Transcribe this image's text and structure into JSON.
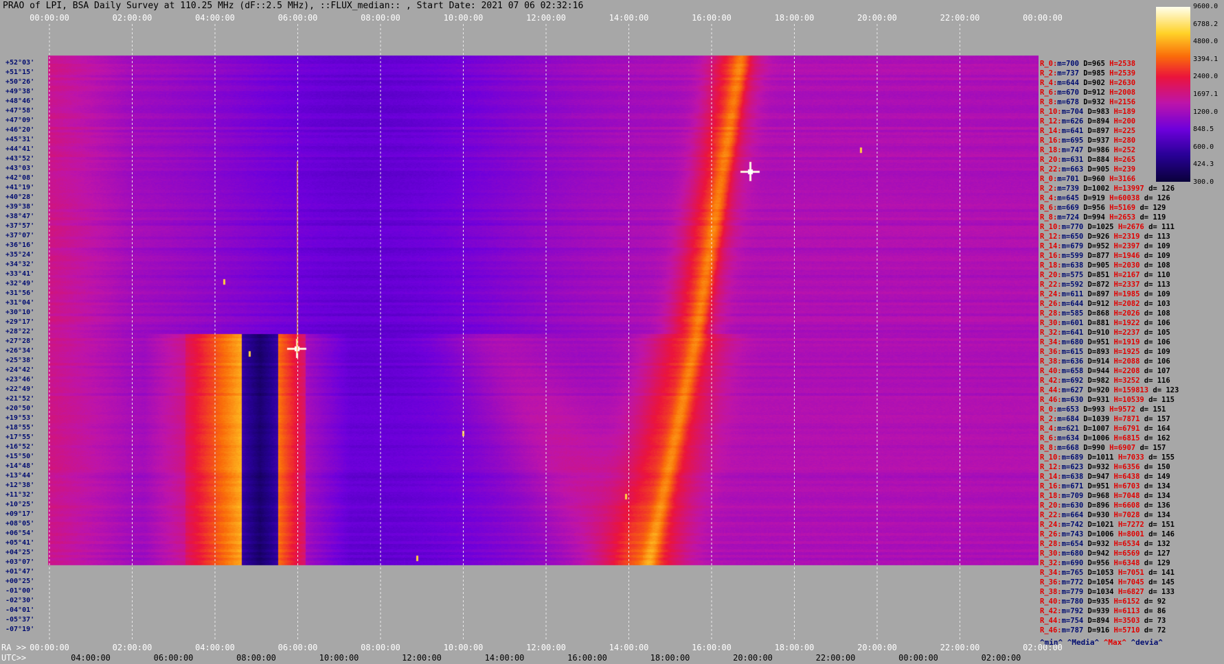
{
  "title": "PRAO of LPI, BSA Daily Survey at 110.25 MHz (dF::2.5 MHz), ::FLUX_median:: , Start Date: 2021 07 06 02:32:16",
  "axis_labels": {
    "ra": "RA >>",
    "utc": "UTC>>"
  },
  "footer": {
    "min": "^min^",
    "media": "^Media^",
    "max": "^Max^",
    "devia": "^devia^"
  },
  "chart_data": {
    "type": "heatmap",
    "title": "PRAO of LPI, BSA Daily Survey at 110.25 MHz (dF::2.5 MHz), ::FLUX_median:: , Start Date: 2021 07 06 02:32:16",
    "x_top_ticks": [
      "00:00:00",
      "02:00:00",
      "04:00:00",
      "06:00:00",
      "08:00:00",
      "10:00:00",
      "12:00:00",
      "14:00:00",
      "16:00:00",
      "18:00:00",
      "20:00:00",
      "22:00:00",
      "00:00:00"
    ],
    "x_ra_ticks": [
      "00:00:00",
      "02:00:00",
      "04:00:00",
      "06:00:00",
      "08:00:00",
      "10:00:00",
      "12:00:00",
      "14:00:00",
      "16:00:00",
      "18:00:00",
      "20:00:00",
      "22:00:00",
      "02:00:00"
    ],
    "x_utc_ticks": [
      "04:00:00",
      "06:00:00",
      "08:00:00",
      "10:00:00",
      "12:00:00",
      "14:00:00",
      "16:00:00",
      "18:00:00",
      "20:00:00",
      "22:00:00",
      "00:00:00",
      "02:00:00"
    ],
    "colorbar": {
      "ticks": [
        "9600.0",
        "6788.2",
        "4800.0",
        "3394.1",
        "2400.0",
        "1697.1",
        "1200.0",
        "848.5",
        "600.0",
        "424.3",
        "300.0"
      ],
      "range": [
        300,
        9600
      ],
      "scale": "log"
    },
    "dec_labels": [
      "+52°03'",
      "+51°15'",
      "+50°26'",
      "+49°38'",
      "+48°46'",
      "+47°58'",
      "+47°09'",
      "+46°20'",
      "+45°31'",
      "+44°41'",
      "+43°52'",
      "+43°03'",
      "+42°08'",
      "+41°19'",
      "+40°28'",
      "+39°38'",
      "+38°47'",
      "+37°57'",
      "+37°07'",
      "+36°16'",
      "+35°24'",
      "+34°32'",
      "+33°41'",
      "+32°49'",
      "+31°56'",
      "+31°04'",
      "+30°10'",
      "+29°17'",
      "+28°22'",
      "+27°28'",
      "+26°34'",
      "+25°38'",
      "+24°42'",
      "+23°46'",
      "+22°49'",
      "+21°52'",
      "+20°50'",
      "+19°53'",
      "+18°55'",
      "+17°55'",
      "+16°52'",
      "+15°50'",
      "+14°48'",
      "+13°44'",
      "+12°38'",
      "+11°32'",
      "+10°25'",
      "+09°17'",
      "+08°05'",
      "+06°54'",
      "+05°41'",
      "+04°25'",
      "+03°07'",
      "+01°47'",
      "+00°25'",
      "-01°00'",
      "-02°30'",
      "-04°01'",
      "-05°37'",
      "-07°19'"
    ],
    "row_stats": [
      {
        "r": "R_0:",
        "m": "m=700",
        "d": "D=965",
        "h": "H=2538",
        "dev": ""
      },
      {
        "r": "R_2:",
        "m": "m=737",
        "d": "D=985",
        "h": "H=2539",
        "dev": ""
      },
      {
        "r": "R_4:",
        "m": "m=644",
        "d": "D=902",
        "h": "H=2630",
        "dev": ""
      },
      {
        "r": "R_6:",
        "m": "m=670",
        "d": "D=912",
        "h": "H=2008",
        "dev": ""
      },
      {
        "r": "R_8:",
        "m": "m=678",
        "d": "D=932",
        "h": "H=2156",
        "dev": ""
      },
      {
        "r": "R_10:",
        "m": "m=704",
        "d": "D=983",
        "h": "H=189",
        "dev": ""
      },
      {
        "r": "R_12:",
        "m": "m=626",
        "d": "D=894",
        "h": "H=200",
        "dev": ""
      },
      {
        "r": "R_14:",
        "m": "m=641",
        "d": "D=897",
        "h": "H=225",
        "dev": ""
      },
      {
        "r": "R_16:",
        "m": "m=695",
        "d": "D=937",
        "h": "H=280",
        "dev": ""
      },
      {
        "r": "R_18:",
        "m": "m=747",
        "d": "D=986",
        "h": "H=252",
        "dev": ""
      },
      {
        "r": "R_20:",
        "m": "m=631",
        "d": "D=884",
        "h": "H=265",
        "dev": ""
      },
      {
        "r": "R_22:",
        "m": "m=663",
        "d": "D=905",
        "h": "H=239",
        "dev": ""
      },
      {
        "r": "R_0:",
        "m": "m=701",
        "d": "D=960",
        "h": "H=3166",
        "dev": ""
      },
      {
        "r": "R_2:",
        "m": "m=739",
        "d": "D=1002",
        "h": "H=13997",
        "dev": "d= 126"
      },
      {
        "r": "R_4:",
        "m": "m=645",
        "d": "D=919",
        "h": "H=60038",
        "dev": "d= 126"
      },
      {
        "r": "R_6:",
        "m": "m=669",
        "d": "D=956",
        "h": "H=5169",
        "dev": "d= 129"
      },
      {
        "r": "R_8:",
        "m": "m=724",
        "d": "D=994",
        "h": "H=2653",
        "dev": "d= 119"
      },
      {
        "r": "R_10:",
        "m": "m=770",
        "d": "D=1025",
        "h": "H=2676",
        "dev": "d= 111"
      },
      {
        "r": "R_12:",
        "m": "m=650",
        "d": "D=926",
        "h": "H=2319",
        "dev": "d= 113"
      },
      {
        "r": "R_14:",
        "m": "m=679",
        "d": "D=952",
        "h": "H=2397",
        "dev": "d= 109"
      },
      {
        "r": "R_16:",
        "m": "m=599",
        "d": "D=877",
        "h": "H=1946",
        "dev": "d= 109"
      },
      {
        "r": "R_18:",
        "m": "m=638",
        "d": "D=905",
        "h": "H=2030",
        "dev": "d= 108"
      },
      {
        "r": "R_20:",
        "m": "m=575",
        "d": "D=851",
        "h": "H=2167",
        "dev": "d= 110"
      },
      {
        "r": "R_22:",
        "m": "m=592",
        "d": "D=872",
        "h": "H=2337",
        "dev": "d= 113"
      },
      {
        "r": "R_24:",
        "m": "m=611",
        "d": "D=897",
        "h": "H=1985",
        "dev": "d= 109"
      },
      {
        "r": "R_26:",
        "m": "m=644",
        "d": "D=912",
        "h": "H=2082",
        "dev": "d= 103"
      },
      {
        "r": "R_28:",
        "m": "m=585",
        "d": "D=868",
        "h": "H=2026",
        "dev": "d= 108"
      },
      {
        "r": "R_30:",
        "m": "m=601",
        "d": "D=881",
        "h": "H=1922",
        "dev": "d= 106"
      },
      {
        "r": "R_32:",
        "m": "m=641",
        "d": "D=910",
        "h": "H=2237",
        "dev": "d= 105"
      },
      {
        "r": "R_34:",
        "m": "m=680",
        "d": "D=951",
        "h": "H=1919",
        "dev": "d= 106"
      },
      {
        "r": "R_36:",
        "m": "m=615",
        "d": "D=893",
        "h": "H=1925",
        "dev": "d= 109"
      },
      {
        "r": "R_38:",
        "m": "m=636",
        "d": "D=914",
        "h": "H=2088",
        "dev": "d= 106"
      },
      {
        "r": "R_40:",
        "m": "m=658",
        "d": "D=944",
        "h": "H=2208",
        "dev": "d= 107"
      },
      {
        "r": "R_42:",
        "m": "m=692",
        "d": "D=982",
        "h": "H=3252",
        "dev": "d= 116"
      },
      {
        "r": "R_44:",
        "m": "m=627",
        "d": "D=920",
        "h": "H=159813",
        "dev": "d= 123"
      },
      {
        "r": "R_46:",
        "m": "m=630",
        "d": "D=931",
        "h": "H=10539",
        "dev": "d= 115"
      },
      {
        "r": "R_0:",
        "m": "m=653",
        "d": "D=993",
        "h": "H=9572",
        "dev": "d= 151"
      },
      {
        "r": "R_2:",
        "m": "m=684",
        "d": "D=1039",
        "h": "H=7871",
        "dev": "d= 157"
      },
      {
        "r": "R_4:",
        "m": "m=621",
        "d": "D=1007",
        "h": "H=6791",
        "dev": "d= 164"
      },
      {
        "r": "R_6:",
        "m": "m=634",
        "d": "D=1006",
        "h": "H=6815",
        "dev": "d= 162"
      },
      {
        "r": "R_8:",
        "m": "m=668",
        "d": "D=990",
        "h": "H=6907",
        "dev": "d= 157"
      },
      {
        "r": "R_10:",
        "m": "m=689",
        "d": "D=1011",
        "h": "H=7033",
        "dev": "d= 155"
      },
      {
        "r": "R_12:",
        "m": "m=623",
        "d": "D=932",
        "h": "H=6356",
        "dev": "d= 150"
      },
      {
        "r": "R_14:",
        "m": "m=638",
        "d": "D=947",
        "h": "H=6438",
        "dev": "d= 149"
      },
      {
        "r": "R_16:",
        "m": "m=671",
        "d": "D=951",
        "h": "H=6703",
        "dev": "d= 134"
      },
      {
        "r": "R_18:",
        "m": "m=709",
        "d": "D=968",
        "h": "H=7048",
        "dev": "d= 134"
      },
      {
        "r": "R_20:",
        "m": "m=630",
        "d": "D=896",
        "h": "H=6608",
        "dev": "d= 136"
      },
      {
        "r": "R_22:",
        "m": "m=664",
        "d": "D=930",
        "h": "H=7028",
        "dev": "d= 134"
      },
      {
        "r": "R_24:",
        "m": "m=742",
        "d": "D=1021",
        "h": "H=7272",
        "dev": "d= 151"
      },
      {
        "r": "R_26:",
        "m": "m=743",
        "d": "D=1006",
        "h": "H=8001",
        "dev": "d= 146"
      },
      {
        "r": "R_28:",
        "m": "m=654",
        "d": "D=932",
        "h": "H=6534",
        "dev": "d= 132"
      },
      {
        "r": "R_30:",
        "m": "m=680",
        "d": "D=942",
        "h": "H=6569",
        "dev": "d= 127"
      },
      {
        "r": "R_32:",
        "m": "m=690",
        "d": "D=956",
        "h": "H=6348",
        "dev": "d= 129"
      },
      {
        "r": "R_34:",
        "m": "m=765",
        "d": "D=1053",
        "h": "H=7051",
        "dev": "d= 141"
      },
      {
        "r": "R_36:",
        "m": "m=772",
        "d": "D=1054",
        "h": "H=7045",
        "dev": "d= 145"
      },
      {
        "r": "R_38:",
        "m": "m=779",
        "d": "D=1034",
        "h": "H=6827",
        "dev": "d= 133"
      },
      {
        "r": "R_40:",
        "m": "m=780",
        "d": "D=935",
        "h": "H=6152",
        "dev": "d= 92"
      },
      {
        "r": "R_42:",
        "m": "m=792",
        "d": "D=939",
        "h": "H=6113",
        "dev": "d= 86"
      },
      {
        "r": "R_44:",
        "m": "m=754",
        "d": "D=894",
        "h": "H=3503",
        "dev": "d= 73"
      },
      {
        "r": "R_46:",
        "m": "m=787",
        "d": "D=916",
        "h": "H=5710",
        "dev": "d= 72"
      }
    ]
  },
  "colors": {
    "background": "#a7a7a7",
    "label_blue": "#000c70",
    "label_red": "#e00000"
  }
}
